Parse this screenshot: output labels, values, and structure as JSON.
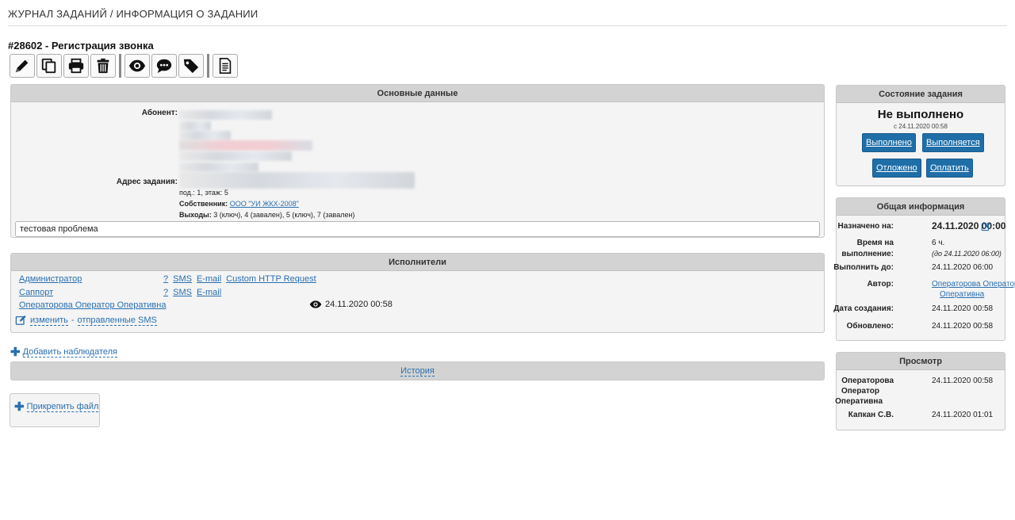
{
  "breadcrumb": "ЖУРНАЛ ЗАДАНИЙ / ИНФОРМАЦИЯ О ЗАДАНИИ",
  "task_title": "#28602 - Регистрация звонка",
  "toolbar": [
    "edit-icon",
    "copy-icon",
    "print-icon",
    "trash-icon",
    "eye-icon",
    "comment-icon",
    "tag-icon",
    "document-icon"
  ],
  "main": {
    "header": "Основные данные",
    "subscriber_label": "Абонент:",
    "address_label": "Адрес задания:",
    "floor": "под.: 1, этаж: 5",
    "owner_label": "Собственник:",
    "owner_value": "ООО \"УИ ЖКХ-2008\"",
    "exits_label": "Выходы:",
    "exits_value": "3 (ключ), 4 (завален), 5 (ключ), 7 (завален)",
    "problem": "тестовая проблема"
  },
  "executors": {
    "header": "Исполнители",
    "rows": [
      {
        "name": "Администратор",
        "links": [
          "?",
          "SMS",
          "E-mail",
          "Custom HTTP Request"
        ]
      },
      {
        "name": "Саппорт",
        "links": [
          "?",
          "SMS",
          "E-mail"
        ]
      },
      {
        "name": "Операторова Оператор Оперативна",
        "viewed": "24.11.2020 00:58"
      }
    ],
    "change_link": "изменить",
    "sep": "-",
    "sent_sms_link": "отправленные SMS"
  },
  "add_watcher": "Добавить наблюдателя",
  "history": "История",
  "attach_file": "Прикрепить файл",
  "status_panel": {
    "header": "Состояние задания",
    "status": "Не выполнено",
    "since": "с 24.11.2020 00:58",
    "buttons": [
      "Выполнено",
      "Выполняется",
      "Отложено",
      "Оплатить"
    ]
  },
  "general_info": {
    "header": "Общая информация",
    "assigned_label": "Назначено на:",
    "assigned_value": "24.11.2020 00:00",
    "duration_label_1": "Время на",
    "duration_label_2": "выполнение:",
    "duration_value": "6 ч.",
    "duration_until": "(до 24.11.2020 06:00)",
    "deadline_label": "Выполнить до:",
    "deadline_value": "24.11.2020 06:00",
    "author_label": "Автор:",
    "author_value_1": "Операторова Оператор",
    "author_value_2": "Оперативна",
    "created_label": "Дата создания:",
    "created_value": "24.11.2020 00:58",
    "updated_label": "Обновлено:",
    "updated_value": "24.11.2020 00:58"
  },
  "views": {
    "header": "Просмотр",
    "rows": [
      {
        "name_1": "Операторова",
        "name_2": "Оператор",
        "name_3": "Оперативна",
        "time": "24.11.2020 00:58"
      },
      {
        "name_1": "Капкан С.В.",
        "time": "24.11.2020 01:01"
      }
    ]
  },
  "colors": {
    "link": "#2a6fb0",
    "button": "#1f6ea8",
    "panel_header": "#d3d3d3",
    "panel_bg": "#f4f4f4"
  }
}
